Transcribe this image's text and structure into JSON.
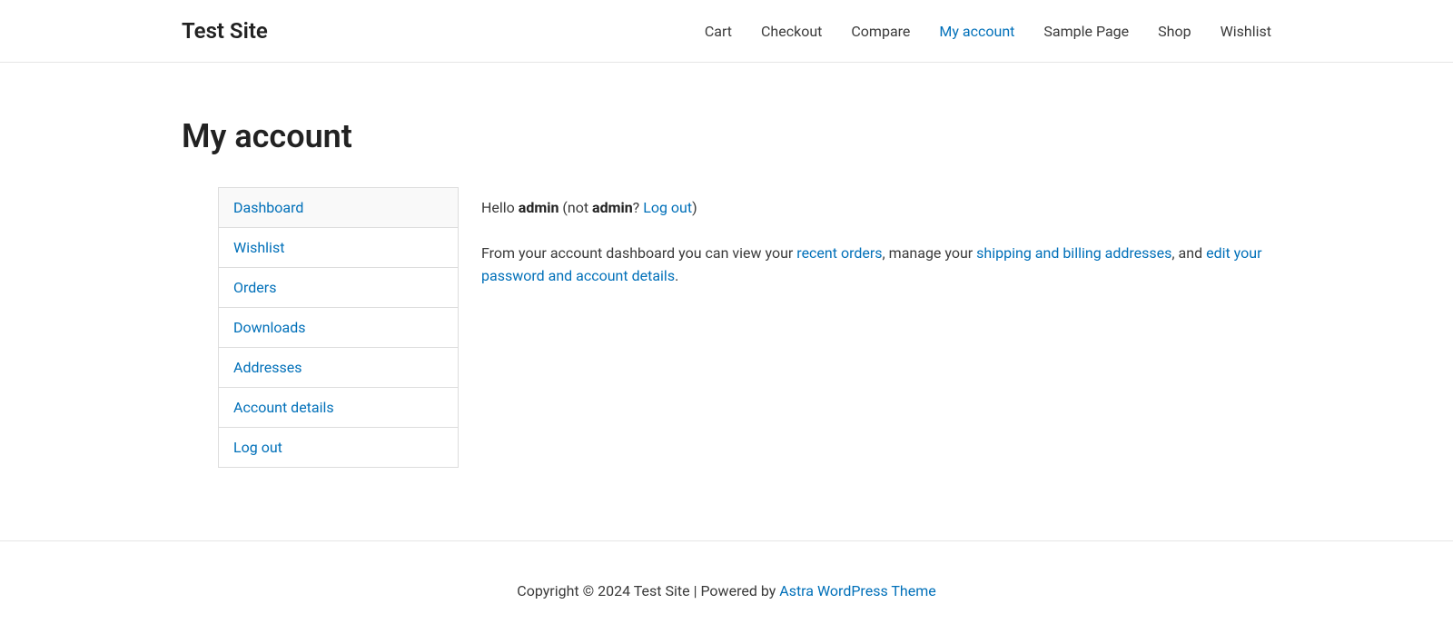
{
  "site": {
    "title": "Test Site"
  },
  "nav": {
    "items": [
      {
        "label": "Cart",
        "active": false
      },
      {
        "label": "Checkout",
        "active": false
      },
      {
        "label": "Compare",
        "active": false
      },
      {
        "label": "My account",
        "active": true
      },
      {
        "label": "Sample Page",
        "active": false
      },
      {
        "label": "Shop",
        "active": false
      },
      {
        "label": "Wishlist",
        "active": false
      }
    ]
  },
  "page": {
    "title": "My account"
  },
  "account_nav": {
    "items": [
      {
        "label": "Dashboard",
        "active": true
      },
      {
        "label": "Wishlist",
        "active": false
      },
      {
        "label": "Orders",
        "active": false
      },
      {
        "label": "Downloads",
        "active": false
      },
      {
        "label": "Addresses",
        "active": false
      },
      {
        "label": "Account details",
        "active": false
      },
      {
        "label": "Log out",
        "active": false
      }
    ]
  },
  "dashboard": {
    "greeting": {
      "hello": "Hello ",
      "username1": "admin",
      "not_prefix": " (not ",
      "username2": "admin",
      "question": "? ",
      "logout": "Log out",
      "closing": ")"
    },
    "intro": {
      "text1": "From your account dashboard you can view your ",
      "link1": "recent orders",
      "text2": ", manage your ",
      "link2": "shipping and billing addresses",
      "text3": ", and ",
      "link3": "edit your password and account details",
      "text4": "."
    }
  },
  "footer": {
    "text": "Copyright © 2024 Test Site | Powered by ",
    "link": "Astra WordPress Theme"
  }
}
